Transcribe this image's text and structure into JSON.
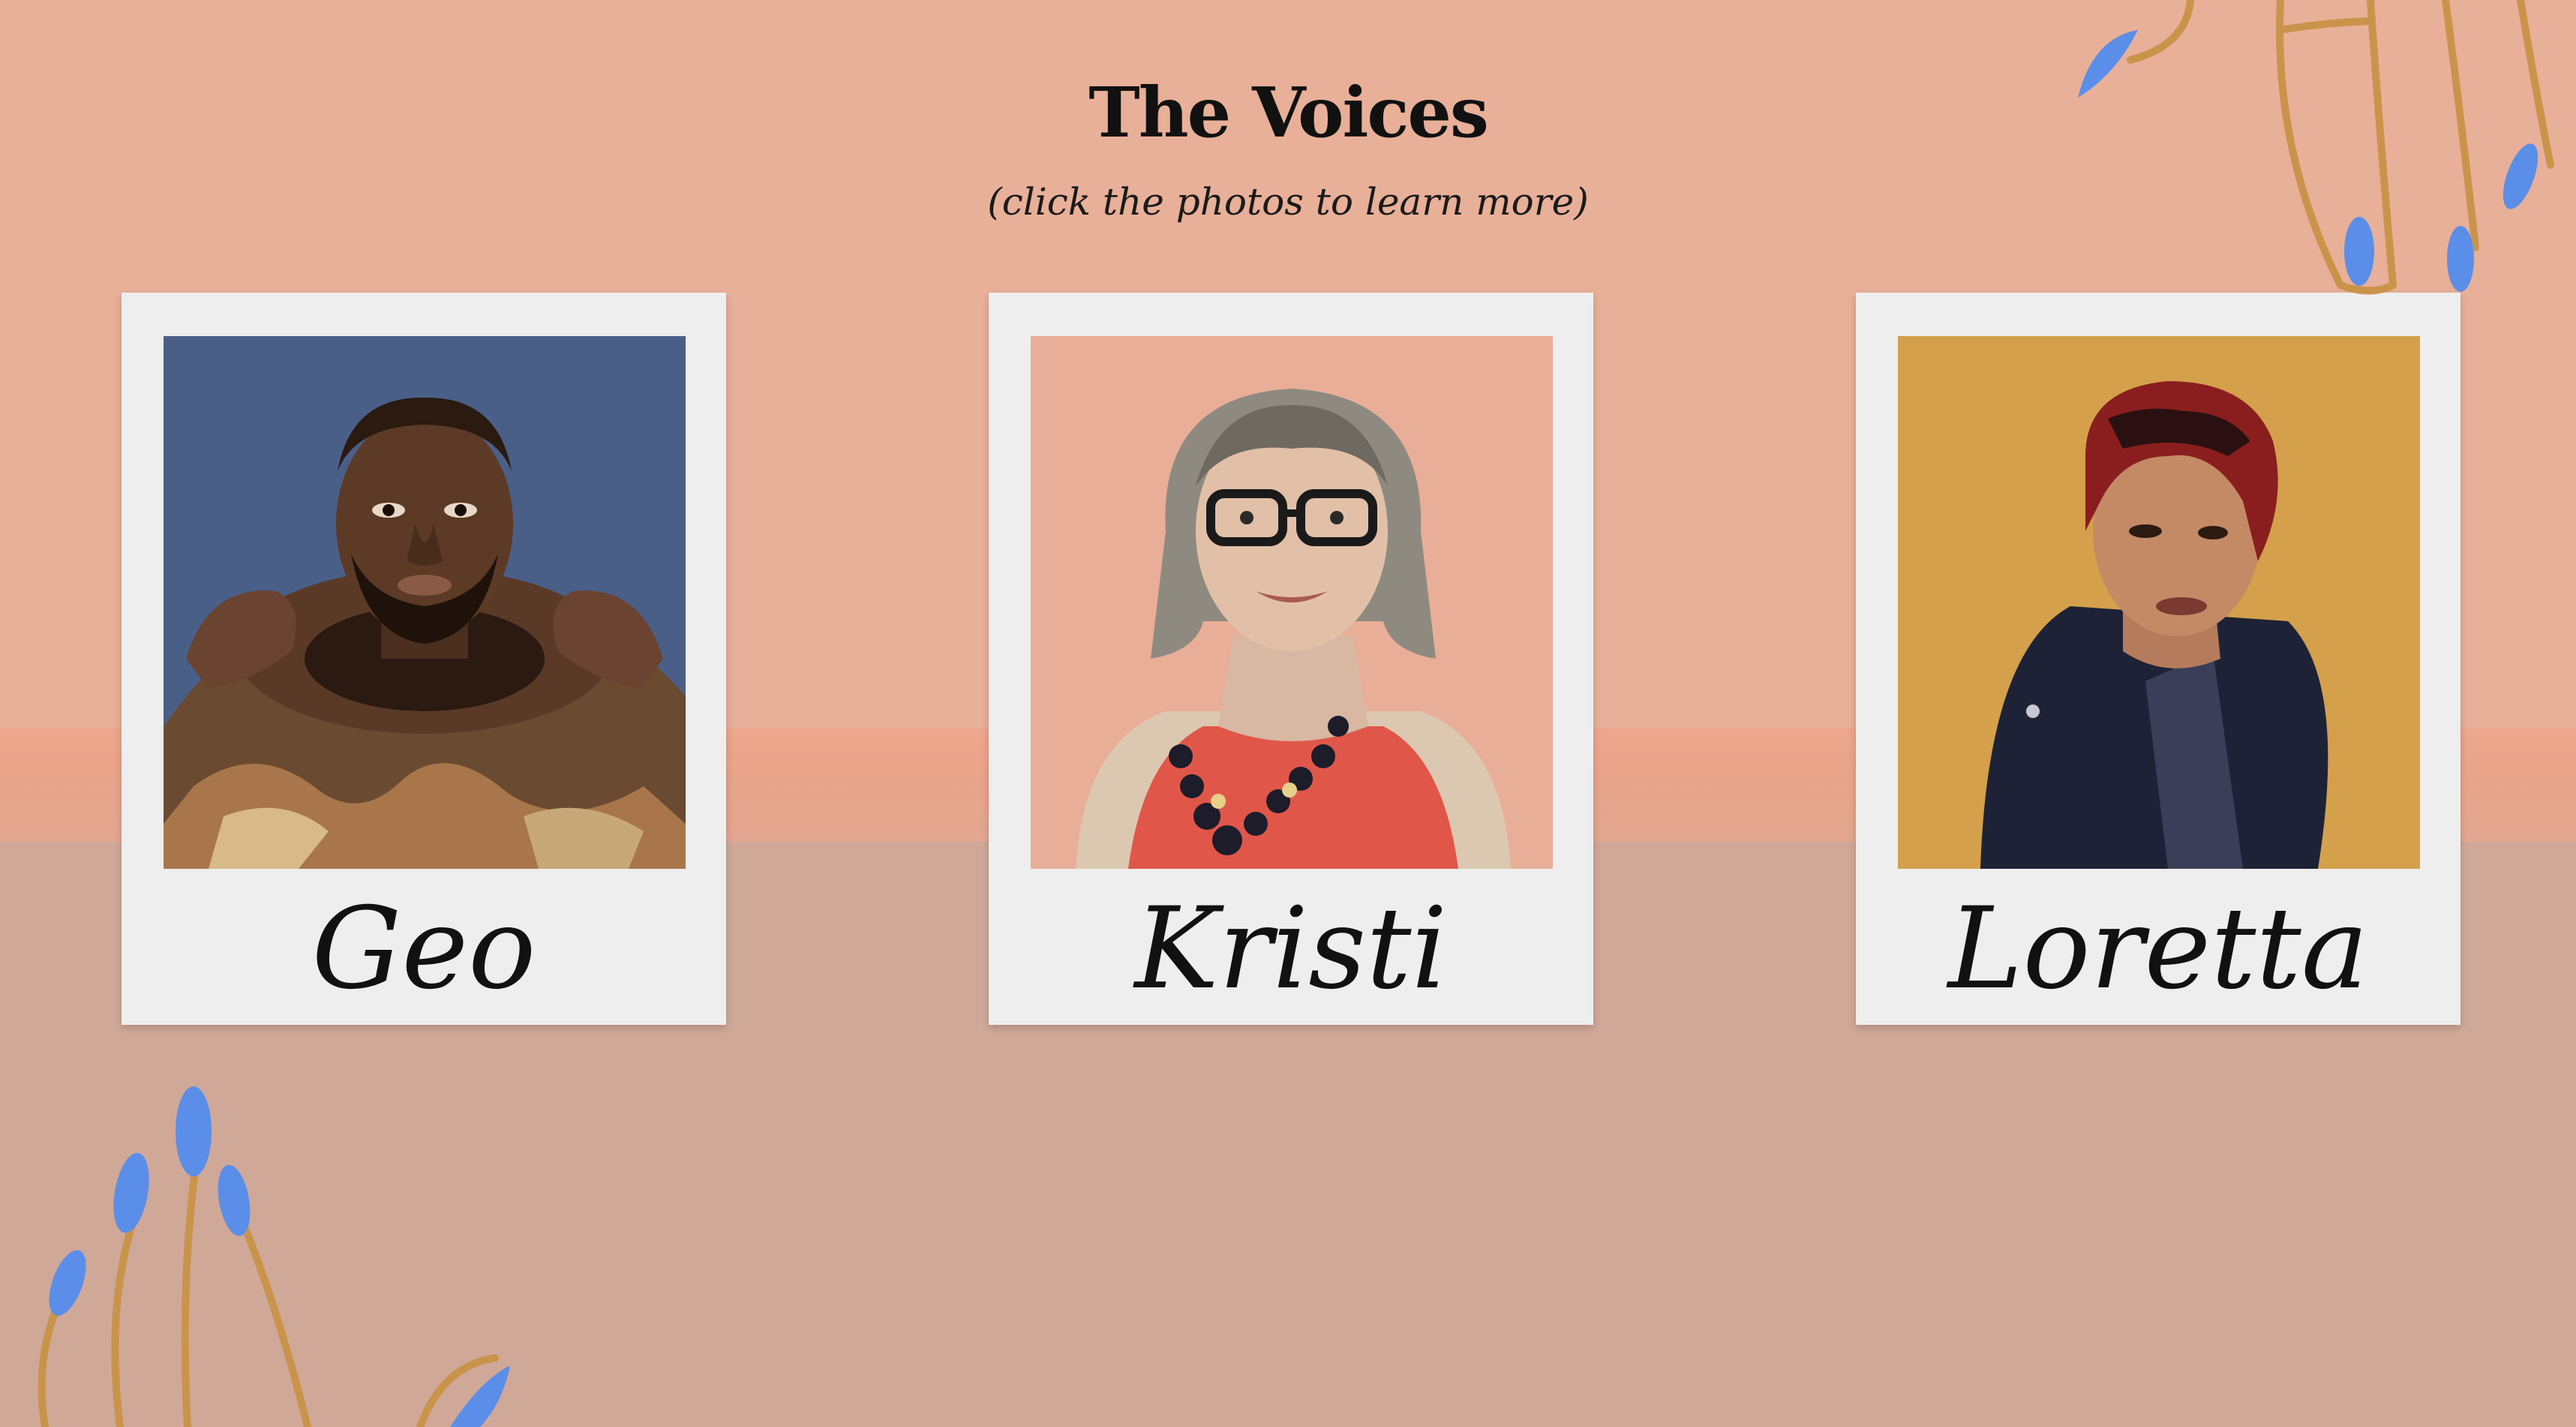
{
  "page": {
    "title": "The Voices",
    "subtitle": "(click the photos to learn more)"
  },
  "colors": {
    "background_top": "#e8b098",
    "background_bottom": "#d0a898",
    "nail": "#5b8ee8",
    "hand_outline": "#c9944a"
  },
  "voices": [
    {
      "name": "Geo",
      "photo_bg": "#4a5f88",
      "icon": "portrait-illustration"
    },
    {
      "name": "Kristi",
      "photo_bg": "#e9ae98",
      "icon": "portrait-illustration"
    },
    {
      "name": "Loretta",
      "photo_bg": "#d4a04c",
      "icon": "portrait-illustration"
    }
  ],
  "decorations": [
    "hand-illustration-top-right",
    "hand-illustration-bottom-left"
  ]
}
